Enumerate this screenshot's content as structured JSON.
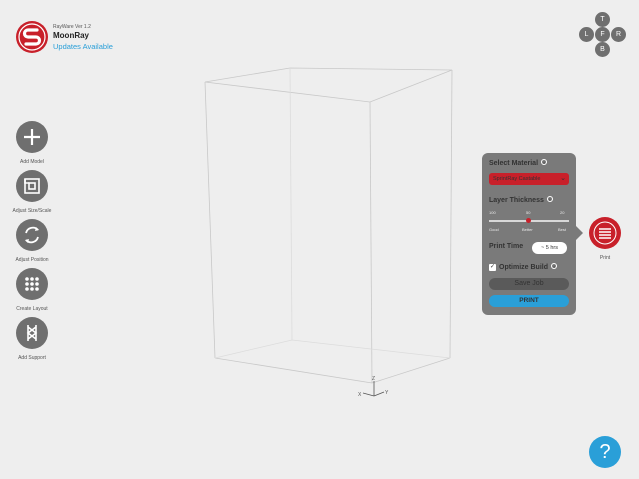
{
  "app": {
    "version": "RayWare Ver 1.2",
    "name": "MoonRay",
    "update_link": "Updates Available"
  },
  "view_nav": {
    "top": "T",
    "left": "L",
    "front": "F",
    "right": "R",
    "bottom": "B"
  },
  "toolbar": [
    {
      "label": "Add Model",
      "icon": "plus-icon"
    },
    {
      "label": "Adjust Size/Scale",
      "icon": "scale-icon"
    },
    {
      "label": "Adjust Position",
      "icon": "rotate-icon"
    },
    {
      "label": "Create Layout",
      "icon": "grid-dots-icon"
    },
    {
      "label": "Add Support",
      "icon": "support-icon"
    }
  ],
  "axis": {
    "x": "X",
    "y": "Y",
    "z": "Z"
  },
  "print_panel": {
    "select_material_label": "Select Material",
    "material_value": "SprintRay Castable",
    "layer_thickness_label": "Layer Thickness",
    "thickness_ticks": [
      "100",
      "50",
      "20"
    ],
    "quality_labels": [
      "Good",
      "Better",
      "Best"
    ],
    "print_time_label": "Print Time",
    "print_time_value": "~ 5 hrs",
    "optimize_build_label": "Optimize Build",
    "optimize_build_checked": true,
    "save_job_label": "Save Job",
    "print_label": "PRINT"
  },
  "print_tool": {
    "label": "Print"
  },
  "help": {
    "label": "?"
  },
  "colors": {
    "brand_red": "#c8202a",
    "accent_blue": "#2a9fd8",
    "tool_grey": "#6f6f6f",
    "panel_grey": "#7a7a7a",
    "background": "#eeeeee"
  }
}
